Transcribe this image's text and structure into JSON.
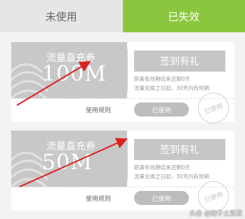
{
  "tabs": {
    "unused": "未使用",
    "expired": "已失效"
  },
  "coupons": [
    {
      "title": "流量直充券",
      "amount": "100M",
      "sign_label": "签到有礼",
      "note1": "距离有效期结束还剩0天",
      "note2": "流量兑换之日起，30天内有效期",
      "rules_label": "使用规则",
      "used_label": "已使用",
      "stamp_label": "已使用"
    },
    {
      "title": "流量直充券",
      "amount": "50M",
      "sign_label": "签到有礼",
      "note1": "距离有效期结束还剩0天",
      "note2": "流量兑换之日起，30天内有效期",
      "rules_label": "使用规则",
      "used_label": "已使用",
      "stamp_label": "已使用"
    }
  ],
  "watermark": "头条 @椒子土豆泥",
  "colors": {
    "tab_active": "#8cc63f",
    "arrow": "#d9221f"
  }
}
